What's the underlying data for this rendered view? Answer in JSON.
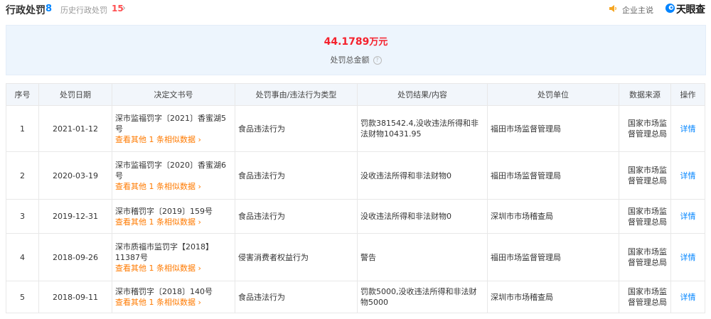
{
  "header": {
    "title": "行政处罚",
    "title_count": "8",
    "history_label": "历史行政处罚",
    "history_count": "15",
    "chevron": "›",
    "enterprise_say": "企业主说",
    "brand": "天眼查"
  },
  "summary": {
    "amount": "44.1789",
    "unit": "万元",
    "label": "处罚总金额",
    "help": "?"
  },
  "table": {
    "headers": [
      "序号",
      "处罚日期",
      "决定文书号",
      "处罚事由/违法行为类型",
      "处罚结果/内容",
      "处罚单位",
      "数据来源",
      "操作"
    ],
    "rows": [
      {
        "idx": "1",
        "date": "2021-01-12",
        "doc": "深市监福罚字〔2021〕香蜜湖5号",
        "similar": "查看其他 1 条相似数据 ›",
        "reason": "食品违法行为",
        "result": "罚款381542.4,没收违法所得和非法财物10431.95",
        "unit": "福田市场监督管理局",
        "source": "国家市场监督管理总局",
        "op": "详情"
      },
      {
        "idx": "2",
        "date": "2020-03-19",
        "doc": "深市监福罚字〔2020〕香蜜湖6号",
        "similar": "查看其他 1 条相似数据 ›",
        "reason": "食品违法行为",
        "result": "没收违法所得和非法财物0",
        "unit": "福田市场监督管理局",
        "source": "国家市场监督管理总局",
        "op": "详情"
      },
      {
        "idx": "3",
        "date": "2019-12-31",
        "doc": "深市稽罚字〔2019〕159号",
        "similar": "查看其他 1 条相似数据 ›",
        "reason": "食品违法行为",
        "result": "没收违法所得和非法财物0",
        "unit": "深圳市市场稽查局",
        "source": "国家市场监督管理总局",
        "op": "详情"
      },
      {
        "idx": "4",
        "date": "2018-09-26",
        "doc": "深市质福市监罚字【2018】11387号",
        "similar": "查看其他 1 条相似数据 ›",
        "reason": "侵害消费者权益行为",
        "result": "警告",
        "unit": "福田市场监督管理局",
        "source": "国家市场监督管理总局",
        "op": "详情"
      },
      {
        "idx": "5",
        "date": "2018-09-11",
        "doc": "深市稽罚字〔2018〕140号",
        "similar": "查看其他 1 条相似数据 ›",
        "reason": "食品违法行为",
        "result": "罚款5000,没收违法所得和非法财物5000",
        "unit": "深圳市市场稽查局",
        "source": "国家市场监督管理总局",
        "op": "详情"
      }
    ]
  },
  "colors": {
    "accent": "#0084ff",
    "amount": "#f5222d",
    "link_orange": "#ff7a00",
    "summary_bg": "#edf5fd",
    "header_bg": "#f2f6fb"
  },
  "icons": [
    "speaker-icon",
    "tianyancha-logo-icon",
    "help-icon",
    "chevron-right-icon"
  ]
}
